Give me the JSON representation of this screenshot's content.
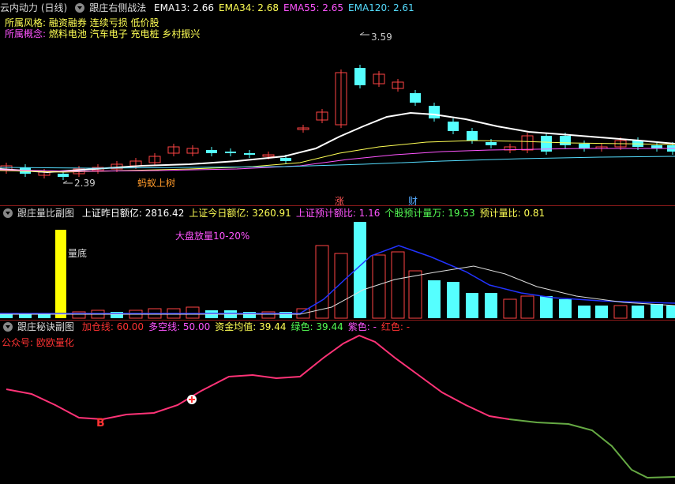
{
  "main": {
    "title": "云内动力 (日线)",
    "indicator": "跟庄右侧战法",
    "ema": [
      {
        "label": "EMA13: 2.66",
        "color": "#ffffff"
      },
      {
        "label": "EMA34: 2.68",
        "color": "#ffff55"
      },
      {
        "label": "EMA55: 2.65",
        "color": "#ff55ff"
      },
      {
        "label": "EMA120: 2.61",
        "color": "#55ddff"
      }
    ],
    "style_label": "所属风格:",
    "style_value": "融资融券 连续亏损 低价股",
    "concept_label": "所属概念:",
    "concept_value": "燃料电池 汽车电子 充电桩 乡村振兴",
    "high_price": "3.59",
    "low_price": "2.39",
    "pattern_label": "蚂蚁上树",
    "marker_zhang": "涨",
    "marker_cai": "财"
  },
  "volume": {
    "indicator": "跟庄量比副图",
    "items": [
      {
        "label": "上证昨日额亿: 2816.42",
        "color": "#ffffff"
      },
      {
        "label": "上证今日额亿: 3260.91",
        "color": "#ffff55"
      },
      {
        "label": "上证预计额比: 1.16",
        "color": "#ff55ff"
      },
      {
        "label": "个股预计量万: 19.53",
        "color": "#55ff55"
      },
      {
        "label": "预计量比: 0.81",
        "color": "#ffff55"
      }
    ],
    "bottom_label": "量底",
    "annotation": "大盘放量10-20%"
  },
  "secret": {
    "indicator": "跟庄秘诀副图",
    "items": [
      {
        "label": "加仓线: 60.00",
        "color": "#ff3333"
      },
      {
        "label": "多空线: 50.00",
        "color": "#ff55ff"
      },
      {
        "label": "资金均值: 39.44",
        "color": "#ffff55"
      },
      {
        "label": "绿色: 39.44",
        "color": "#55ff55"
      },
      {
        "label": "紫色: -",
        "color": "#ff55ff"
      },
      {
        "label": "红色: -",
        "color": "#ff3333"
      }
    ],
    "public_account": "公众号: 欧欧量化",
    "buy_label": "B"
  }
}
